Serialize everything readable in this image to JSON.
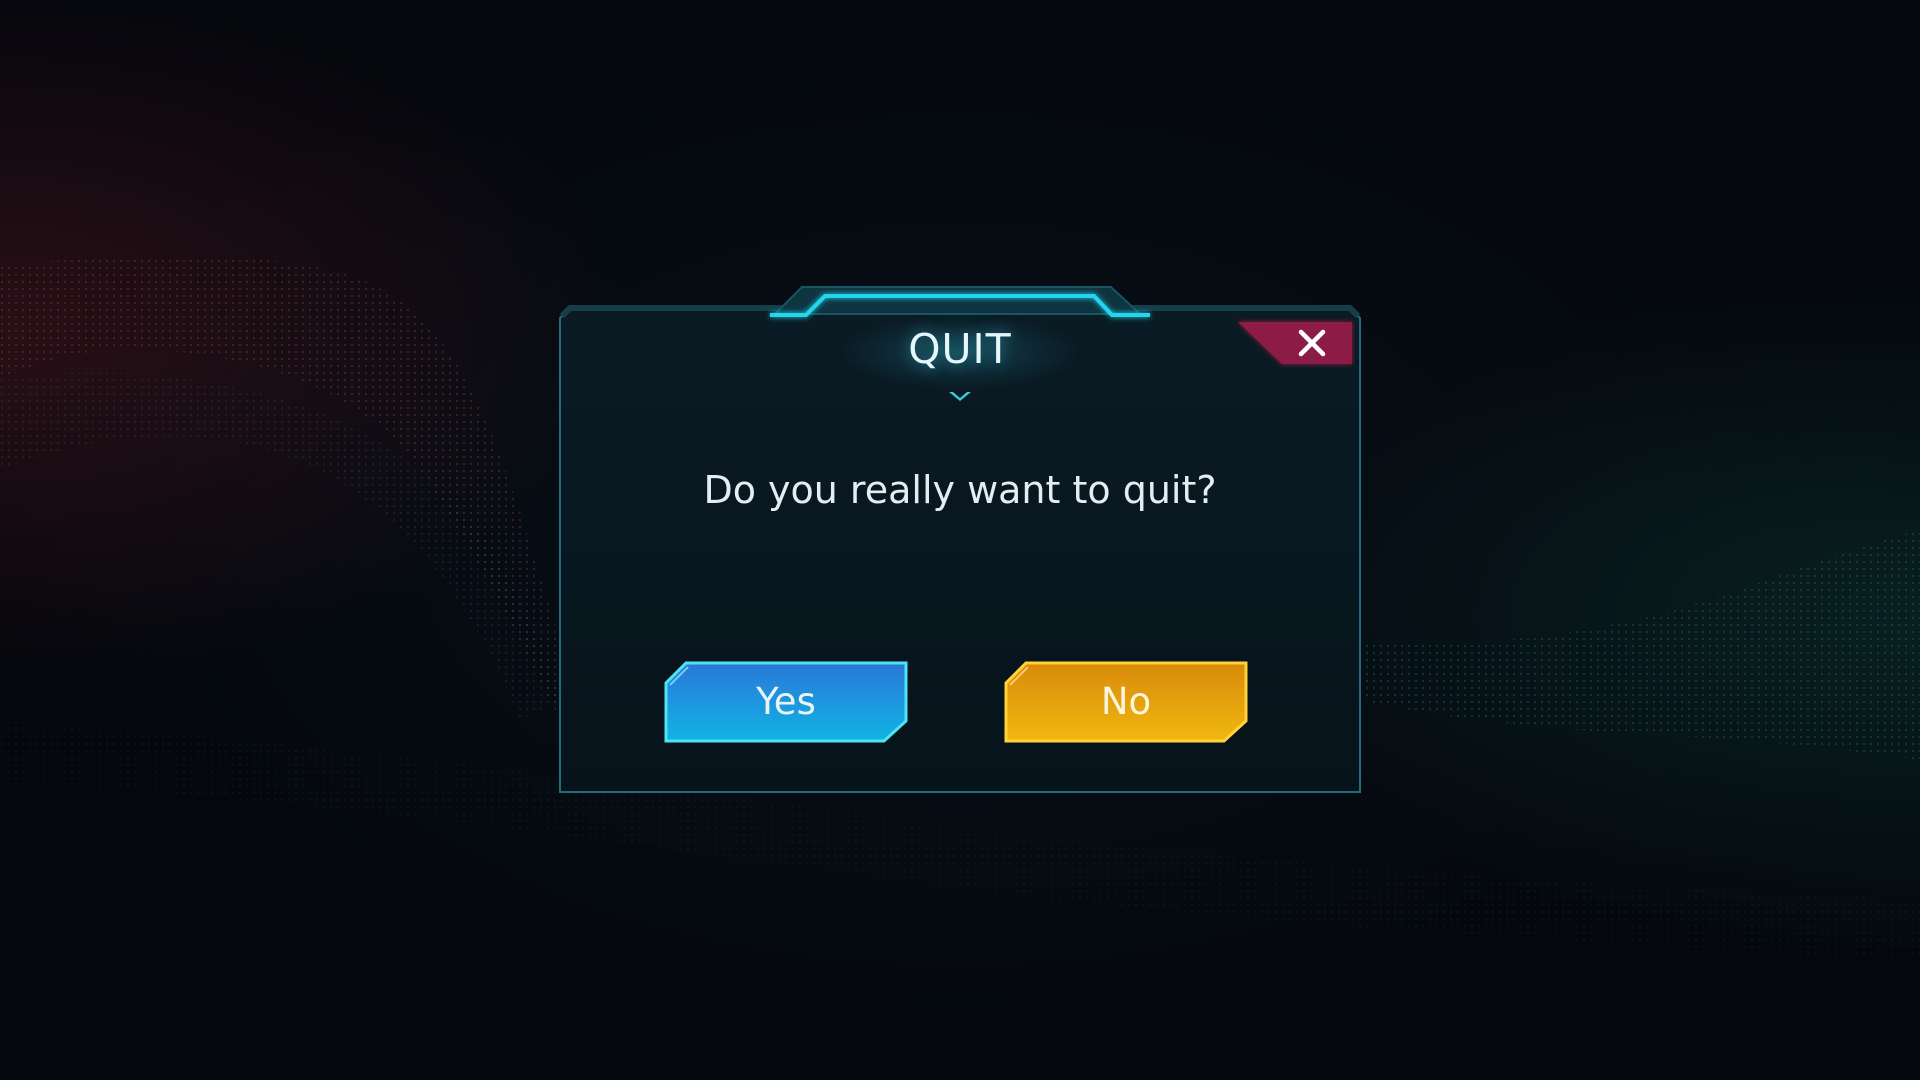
{
  "dialog": {
    "title": "QUIT",
    "message": "Do you really want to quit?",
    "yes_label": "Yes",
    "no_label": "No",
    "close_icon": "close-icon"
  },
  "colors": {
    "frame_accent": "#24d6ee",
    "close_bg": "#8c1a45",
    "yes_button": "#1a8fd6",
    "no_button": "#e6a60c"
  }
}
